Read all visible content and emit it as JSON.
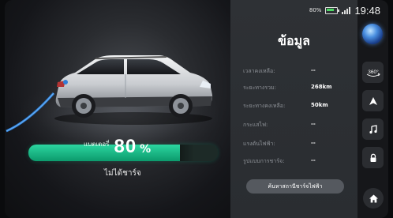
{
  "status_bar": {
    "battery_percent": "80%",
    "time": "19:48",
    "battery_icon": "battery-icon",
    "signal_icon": "signal-icon"
  },
  "charging": {
    "soc_label": "แบตเตอรี่",
    "soc_value": "80",
    "soc_unit": "%",
    "soc_fraction": 0.8,
    "status_text": "ไม่ได้ชาร์จ",
    "accent_color": "#1fbf8a"
  },
  "info": {
    "title": "ข้อมูล",
    "rows": [
      {
        "label": "เวลาคงเหลือ:",
        "value": "--"
      },
      {
        "label": "ระยะทางรวม:",
        "value": "268km"
      },
      {
        "label": "ระยะทางคงเหลือ:",
        "value": "50km"
      },
      {
        "label": "กระแสไฟ:",
        "value": "--"
      },
      {
        "label": "แรงดันไฟฟ้า:",
        "value": "--"
      },
      {
        "label": "รูปแบบการชาร์จ:",
        "value": "--"
      }
    ],
    "find_station_label": "ค้นหาสถานีชาร์จไฟฟ้า"
  },
  "nav": {
    "items": [
      {
        "name": "360-view",
        "icon": "360-camera-icon",
        "label": "360°"
      },
      {
        "name": "navigation",
        "icon": "navigation-arrow-icon"
      },
      {
        "name": "music",
        "icon": "music-note-icon"
      },
      {
        "name": "lock",
        "icon": "lock-icon"
      }
    ],
    "home_icon": "home-icon",
    "assistant_icon": "voice-assistant-icon"
  }
}
